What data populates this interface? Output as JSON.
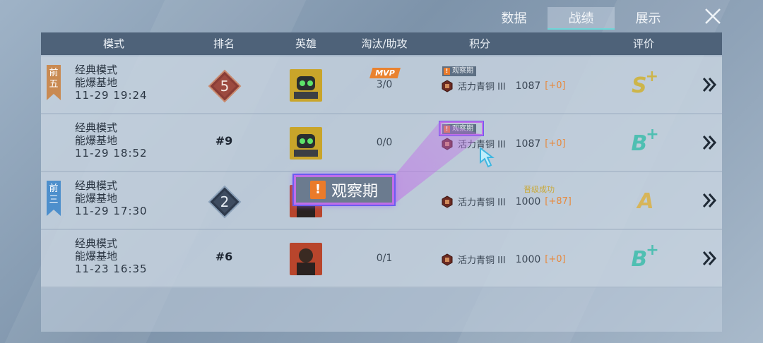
{
  "tabs": [
    {
      "label": "数据",
      "active": false
    },
    {
      "label": "战绩",
      "active": true
    },
    {
      "label": "展示",
      "active": false
    }
  ],
  "columns": [
    "模式",
    "排名",
    "英雄",
    "淘汰/助攻",
    "积分",
    "评价"
  ],
  "rows": [
    {
      "flag": "前五",
      "flag_color": "#c98a52",
      "mode": "经典模式",
      "map": "能爆基地",
      "time": "11-29 19:24",
      "rank_badge": "5",
      "hero_icon": "robot-hero-icon",
      "mvp": "MVP",
      "kda": "3/0",
      "obs_tag": "观察期",
      "tier": "活力青铜 III",
      "points": "1087",
      "delta": "[+0]",
      "extra_label": "",
      "grade": "S",
      "grade_plus": "+",
      "grade_color": "#cdb54a"
    },
    {
      "flag": "",
      "mode": "经典模式",
      "map": "能爆基地",
      "time": "11-29 18:52",
      "rank_text": "#9",
      "hero_icon": "robot-hero-icon",
      "mvp": "",
      "kda": "0/0",
      "obs_tag": "观察期",
      "tier": "活力青铜 III",
      "points": "1087",
      "delta": "[+0]",
      "extra_label": "",
      "grade": "B",
      "grade_plus": "+",
      "grade_color": "#4fbfb2"
    },
    {
      "flag": "前三",
      "flag_color": "#4d8fcc",
      "mode": "经典模式",
      "map": "能爆基地",
      "time": "11-29 17:30",
      "rank_badge": "2",
      "hero_icon": "warrior-hero-icon",
      "mvp": "",
      "kda": "",
      "obs_tag": "",
      "tier": "活力青铜 III",
      "points": "1000",
      "delta": "[+87]",
      "extra_label": "晋级成功",
      "grade": "A",
      "grade_plus": "",
      "grade_color": "#d7b55a"
    },
    {
      "flag": "",
      "mode": "经典模式",
      "map": "能爆基地",
      "time": "11-23 16:35",
      "rank_text": "#6",
      "hero_icon": "warrior-hero-icon",
      "mvp": "",
      "kda": "0/1",
      "obs_tag": "",
      "tier": "活力青铜 III",
      "points": "1000",
      "delta": "[+0]",
      "extra_label": "",
      "grade": "B",
      "grade_plus": "+",
      "grade_color": "#4fbfb2"
    }
  ],
  "callout": {
    "label": "观察期"
  },
  "colors": {
    "header": "#4e6279",
    "accent_tab": "#6fd6d8",
    "highlight": "#c06ee8",
    "delta": "#e8883a"
  }
}
